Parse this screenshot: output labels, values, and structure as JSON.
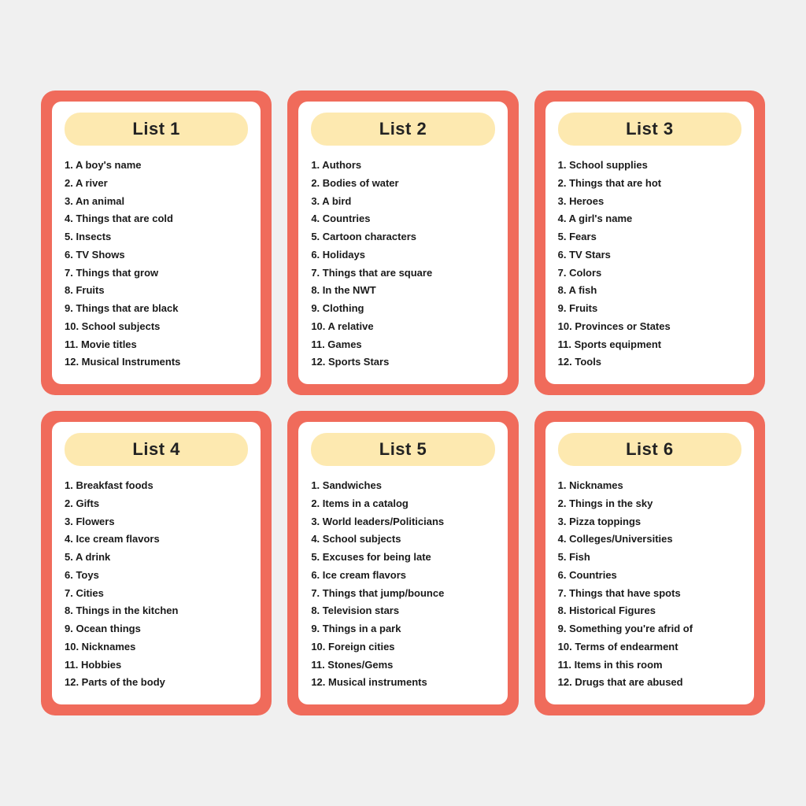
{
  "lists": [
    {
      "id": "list1",
      "title": "List 1",
      "items": [
        "1. A boy's name",
        "2. A river",
        "3. An animal",
        "4. Things that are cold",
        "5. Insects",
        "6. TV Shows",
        "7. Things that grow",
        "8. Fruits",
        "9. Things that are black",
        "10. School subjects",
        "11. Movie titles",
        "12. Musical Instruments"
      ]
    },
    {
      "id": "list2",
      "title": "List 2",
      "items": [
        "1. Authors",
        "2. Bodies of water",
        "3. A bird",
        "4. Countries",
        "5. Cartoon characters",
        "6. Holidays",
        "7. Things that are square",
        "8. In the NWT",
        "9. Clothing",
        "10. A relative",
        "11. Games",
        "12. Sports Stars"
      ]
    },
    {
      "id": "list3",
      "title": "List 3",
      "items": [
        "1. School supplies",
        "2. Things that are hot",
        "3. Heroes",
        "4. A girl's name",
        "5. Fears",
        "6. TV Stars",
        "7. Colors",
        "8. A fish",
        "9. Fruits",
        "10. Provinces or States",
        "11. Sports equipment",
        "12. Tools"
      ]
    },
    {
      "id": "list4",
      "title": "List 4",
      "items": [
        "1. Breakfast foods",
        "2. Gifts",
        "3. Flowers",
        "4. Ice cream flavors",
        "5. A drink",
        "6. Toys",
        "7. Cities",
        "8. Things in the kitchen",
        "9. Ocean things",
        "10. Nicknames",
        "11. Hobbies",
        "12. Parts of the body"
      ]
    },
    {
      "id": "list5",
      "title": "List 5",
      "items": [
        "1. Sandwiches",
        "2. Items in a catalog",
        "3. World leaders/Politicians",
        "4. School subjects",
        "5. Excuses for being late",
        "6. Ice cream flavors",
        "7. Things that jump/bounce",
        "8. Television stars",
        "9. Things in a park",
        "10. Foreign cities",
        "11. Stones/Gems",
        "12. Musical instruments"
      ]
    },
    {
      "id": "list6",
      "title": "List 6",
      "items": [
        "1. Nicknames",
        "2. Things in the sky",
        "3. Pizza toppings",
        "4. Colleges/Universities",
        "5. Fish",
        "6. Countries",
        "7. Things that have spots",
        "8. Historical Figures",
        "9. Something you're afrid of",
        "10. Terms of endearment",
        "11. Items in this room",
        "12. Drugs that are abused"
      ]
    }
  ]
}
